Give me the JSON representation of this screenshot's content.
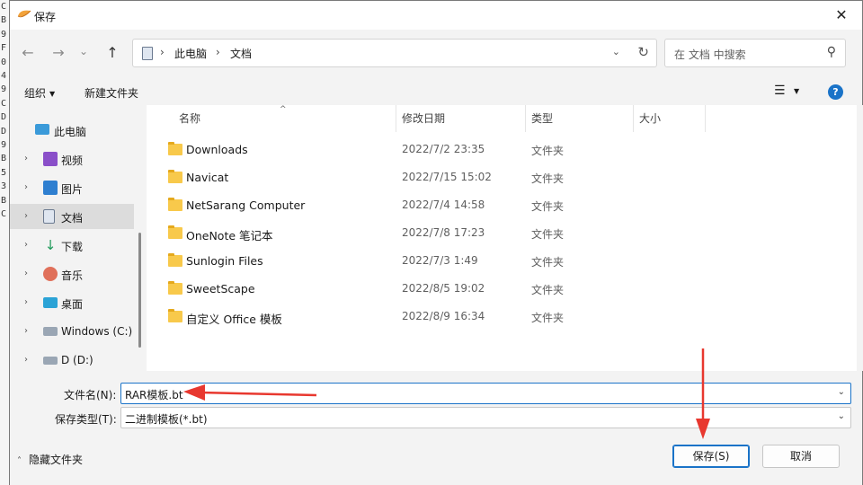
{
  "background_code_chars": [
    "C",
    "B",
    "9",
    "F",
    "0",
    "4",
    "9",
    "C",
    "D",
    "D",
    "9",
    "B",
    "5",
    "3",
    "B",
    "C"
  ],
  "window": {
    "title": "保存",
    "close_glyph": "✕"
  },
  "nav": {
    "back_glyph": "←",
    "forward_glyph": "→",
    "recent_glyph": "⌄",
    "up_glyph": "↑",
    "breadcrumb": [
      "此电脑",
      "文档"
    ],
    "separator": "›",
    "dropdown_glyph": "⌄",
    "refresh_glyph": "↻",
    "search_placeholder": "在 文档 中搜索",
    "search_glyph": "⚲"
  },
  "commands": {
    "organize_label": "组织",
    "organize_caret": "▼",
    "new_folder_label": "新建文件夹",
    "view_glyph": "☰",
    "view_caret": "▼",
    "help_glyph": "?"
  },
  "navpane": {
    "chevron": "›",
    "items": [
      {
        "label": "此电脑",
        "icon": "computer-icon"
      },
      {
        "label": "视频",
        "icon": "video-icon"
      },
      {
        "label": "图片",
        "icon": "pictures-icon"
      },
      {
        "label": "文档",
        "icon": "documents-icon",
        "selected": true
      },
      {
        "label": "下载",
        "icon": "download-icon"
      },
      {
        "label": "音乐",
        "icon": "music-icon"
      },
      {
        "label": "桌面",
        "icon": "desktop-icon"
      },
      {
        "label": "Windows (C:)",
        "icon": "drive-c-icon"
      },
      {
        "label": "D (D:)",
        "icon": "drive-d-icon"
      }
    ]
  },
  "columns": {
    "name": "名称",
    "modified": "修改日期",
    "type": "类型",
    "size": "大小",
    "sort_glyph": "^"
  },
  "files": [
    {
      "name": "Downloads",
      "modified": "2022/7/2 23:35",
      "type": "文件夹"
    },
    {
      "name": "Navicat",
      "modified": "2022/7/15 15:02",
      "type": "文件夹"
    },
    {
      "name": "NetSarang Computer",
      "modified": "2022/7/4 14:58",
      "type": "文件夹"
    },
    {
      "name": "OneNote 笔记本",
      "modified": "2022/7/8 17:23",
      "type": "文件夹"
    },
    {
      "name": "Sunlogin Files",
      "modified": "2022/7/3 1:49",
      "type": "文件夹"
    },
    {
      "name": "SweetScape",
      "modified": "2022/8/5 19:02",
      "type": "文件夹"
    },
    {
      "name": "自定义 Office 模板",
      "modified": "2022/8/9 16:34",
      "type": "文件夹"
    }
  ],
  "form": {
    "filename_label": "文件名(N):",
    "filename_value": "RAR模板.bt",
    "filetype_label": "保存类型(T):",
    "filetype_value": "二进制模板(*.bt)",
    "dropdown_glyph": "⌄"
  },
  "footer": {
    "hide_folders_label": "隐藏文件夹",
    "hide_chevron": "˄",
    "save_label": "保存(S)",
    "cancel_label": "取消"
  },
  "colors": {
    "accent": "#1a73c8",
    "folder": "#f8c94b",
    "annotation": "#e8382f"
  }
}
